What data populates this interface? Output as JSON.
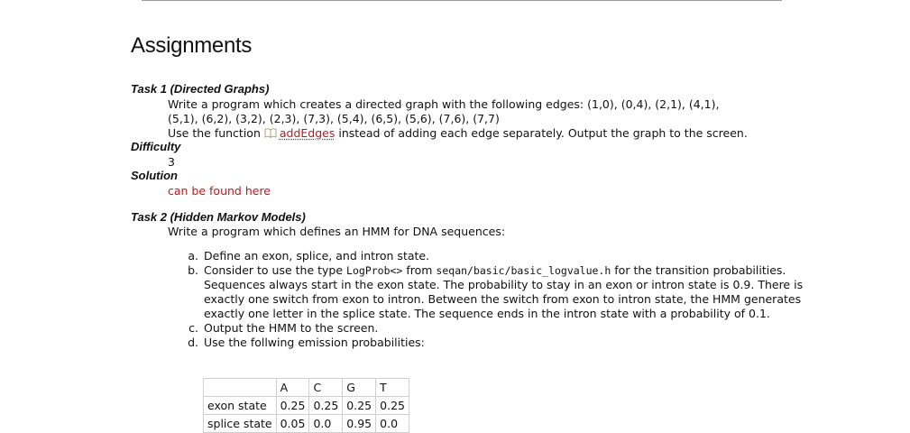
{
  "page": {
    "title": "Assignments"
  },
  "task1": {
    "heading": "Task 1 (Directed Graphs)",
    "desc_line1": "Write a program which creates a directed graph with the following edges: (1,0), (0,4), (2,1), (4,1),",
    "desc_line2": "(5,1), (6,2), (3,2), (2,3), (7,3), (5,4), (6,5), (5,6), (7,6), (7,7)",
    "use_prefix": "Use the function",
    "function_link": "addEdges",
    "use_suffix": "instead of adding each edge separately. Output the graph to the screen.",
    "difficulty_heading": "Difficulty",
    "difficulty_value": "3",
    "solution_heading": "Solution",
    "solution_link": "can be found here"
  },
  "task2": {
    "heading": "Task 2 (Hidden Markov Models)",
    "desc": "Write a program which defines an HMM for DNA sequences:",
    "steps": {
      "a": "Define an exon, splice, and intron state.",
      "b_prefix": "Consider to use the type",
      "b_code1": "LogProb<>",
      "b_mid": "from",
      "b_code2": "seqan/basic/basic_logvalue.h",
      "b_suffix": "for the transition probabilities. Sequences always start in the exon state. The probability to stay in an exon or intron state is 0.9. There is exactly one switch from exon to intron. Between the switch from exon to intron state, the HMM generates exactly one letter in the splice state. The sequence ends in the intron state with a probability of 0.1.",
      "c": "Output the HMM to the screen.",
      "d": "Use the follwing emission probabilities:"
    },
    "emission_table": {
      "corner": "",
      "headers": [
        "A",
        "C",
        "G",
        "T"
      ],
      "rows": [
        {
          "label": "exon state",
          "values": [
            "0.25",
            "0.25",
            "0.25",
            "0.25"
          ]
        },
        {
          "label": "splice state",
          "values": [
            "0.05",
            "0.0",
            "0.95",
            "0.0"
          ]
        }
      ]
    }
  },
  "colors": {
    "link": "#c0171b",
    "text": "#111111",
    "rule": "#9a9a9a"
  },
  "icons": {
    "function_link_icon": "book-icon"
  }
}
